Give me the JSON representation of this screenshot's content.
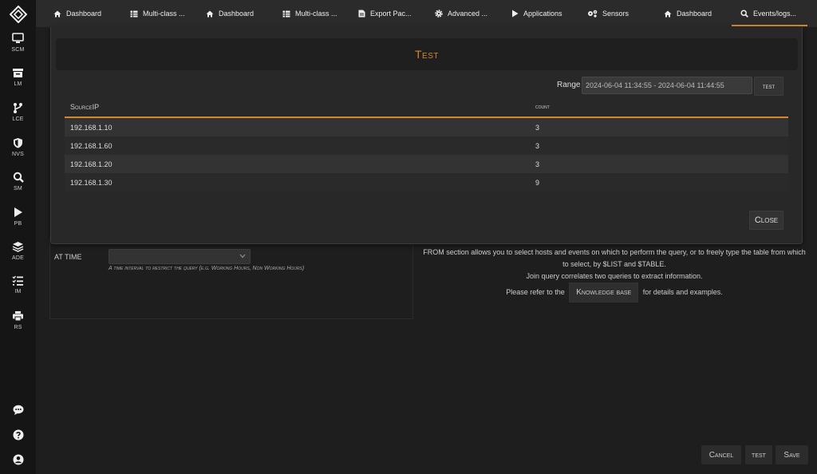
{
  "sidebar": {
    "items": [
      {
        "label": "SCM",
        "icon": "monitor-icon"
      },
      {
        "label": "LM",
        "icon": "archive-icon"
      },
      {
        "label": "LCE",
        "icon": "branch-icon"
      },
      {
        "label": "NVS",
        "icon": "shield-icon"
      },
      {
        "label": "SM",
        "icon": "search-icon"
      },
      {
        "label": "PB",
        "icon": "play-icon"
      },
      {
        "label": "ADE",
        "icon": "layers-icon"
      },
      {
        "label": "IM",
        "icon": "list-icon"
      },
      {
        "label": "RS",
        "icon": "printer-icon"
      }
    ],
    "bottom_icons": [
      "chat-icon",
      "help-icon",
      "user-icon"
    ]
  },
  "tabs": [
    {
      "label": "Dashboard",
      "icon": "home-icon"
    },
    {
      "label": "Multi-class ...",
      "icon": "table-icon"
    },
    {
      "label": "Dashboard",
      "icon": "home-icon"
    },
    {
      "label": "Multi-class ...",
      "icon": "table-icon"
    },
    {
      "label": "Export Pac...",
      "icon": "file-icon"
    },
    {
      "label": "Advanced ...",
      "icon": "gear-icon"
    },
    {
      "label": "Applications",
      "icon": "play-icon"
    },
    {
      "label": "Sensors",
      "icon": "gears-icon"
    },
    {
      "label": "Dashboard",
      "icon": "home-icon"
    },
    {
      "label": "Events/logs...",
      "icon": "search-icon",
      "active": true
    }
  ],
  "modal": {
    "title": "Test",
    "range_label": "Range",
    "range_value": "2024-06-04 11:34:55 - 2024-06-04 11:44:55",
    "test_button": "test",
    "columns": [
      "SourceIP",
      "count"
    ],
    "rows": [
      {
        "source_ip": "192.168.1.10",
        "count": "3"
      },
      {
        "source_ip": "192.168.1.60",
        "count": "3"
      },
      {
        "source_ip": "192.168.1.20",
        "count": "3"
      },
      {
        "source_ip": "192.168.1.30",
        "count": "9"
      }
    ],
    "close_button": "Close"
  },
  "page": {
    "at_time_label": "AT TIME",
    "at_time_help": "A time interval to restrict the query (e.g. Working Hours, Non Working Hours)",
    "info_text_1": "FROM section allows you to select hosts and events on which to perform the query, or to freely type the table from which to select, by $LIST and $TABLE.",
    "info_text_2": "Join query correlates two queries to extract information.",
    "kb_prefix": "Please refer to the",
    "kb_button": "Knowledge base",
    "kb_suffix": "for details and examples.",
    "cancel_button": "Cancel",
    "test_button": "test",
    "save_button": "Save"
  },
  "colors": {
    "accent": "#d4872c",
    "background": "#1e1e1e",
    "sidebar": "#151515"
  }
}
